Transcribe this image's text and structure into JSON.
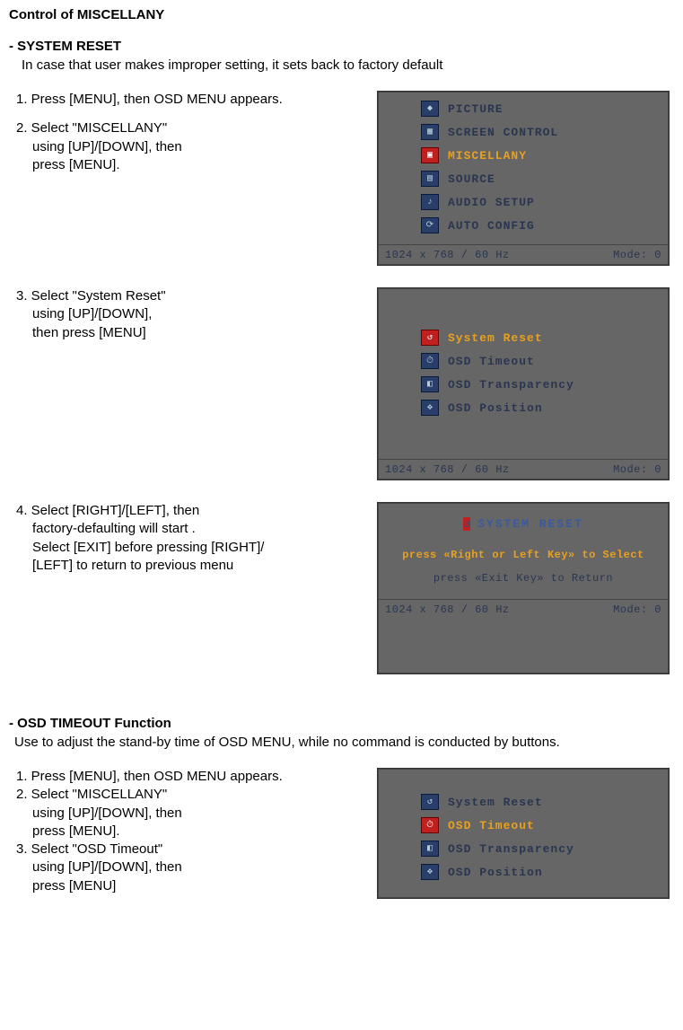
{
  "page": {
    "title": "Control of MISCELLANY",
    "section1": {
      "heading": "- SYSTEM RESET",
      "desc": "In case that user makes improper setting, it sets back to factory default",
      "step1": "1. Press [MENU], then OSD MENU appears.",
      "step2a": "2. Select \"MISCELLANY\"",
      "step2b": "using [UP]/[DOWN], then",
      "step2c": "press  [MENU].",
      "step3a": "3. Select \"System Reset\"",
      "step3b": "using [UP]/[DOWN],",
      "step3c": "then press  [MENU]",
      "step4a": "4. Select [RIGHT]/[LEFT], then",
      "step4b": "factory-defaulting will start .",
      "step4c": "Select [EXIT] before pressing [RIGHT]/",
      "step4d": "[LEFT] to return to previous menu"
    },
    "section2": {
      "heading": "- OSD TIMEOUT Function",
      "desc": "Use to adjust the stand-by time of OSD MENU, while no command is conducted by buttons.",
      "step1": "1. Press [MENU], then OSD MENU appears.",
      "step2a": "2. Select \"MISCELLANY\"",
      "step2b": "using [UP]/[DOWN], then",
      "step2c": "press  [MENU].",
      "step3a": "3. Select \"OSD Timeout\"",
      "step3b": "using [UP]/[DOWN], then",
      "step3c": "press  [MENU]"
    }
  },
  "osd": {
    "statusbar_left": "1024  x   768  /   60  Hz",
    "statusbar_right": "Mode:   0",
    "mainMenu": {
      "items": [
        {
          "label": "PICTURE"
        },
        {
          "label": "SCREEN CONTROL"
        },
        {
          "label": "MISCELLANY"
        },
        {
          "label": "SOURCE"
        },
        {
          "label": "AUDIO SETUP"
        },
        {
          "label": "AUTO CONFIG"
        }
      ],
      "selectedIndex": 2
    },
    "miscMenu": {
      "items": [
        {
          "label": "System Reset"
        },
        {
          "label": "OSD Timeout"
        },
        {
          "label": "OSD Transparency"
        },
        {
          "label": "OSD Position"
        }
      ]
    },
    "resetScreen": {
      "title": "SYSTEM RESET",
      "line1": "press  «Right  or  Left Key»  to Select",
      "line2": "press  «Exit Key»  to Return"
    }
  }
}
